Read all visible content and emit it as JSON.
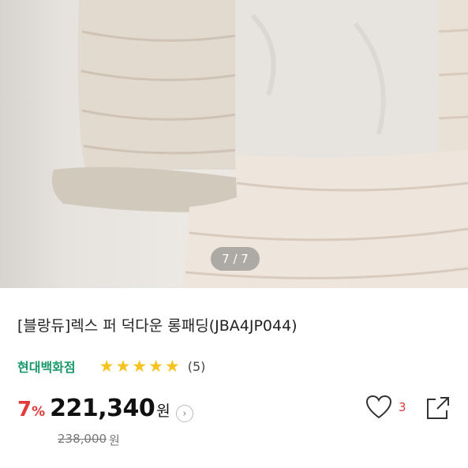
{
  "gallery": {
    "image_alt": "퍼 트리밍 롱패딩 상품 이미지",
    "counter": "7 / 7"
  },
  "product": {
    "title": "[블랑듀]렉스 퍼 덕다운 롱패딩(JBA4JP044)",
    "seller": "현대백화점",
    "rating_stars": 5,
    "review_count": "(5)"
  },
  "pricing": {
    "discount": "7",
    "discount_unit": "%",
    "price": "221,340",
    "currency": "원",
    "original_price": "238,000",
    "original_currency": "원"
  },
  "actions": {
    "like_count": "3",
    "icons": [
      "heart-icon",
      "share-icon",
      "info-chevron-icon"
    ]
  },
  "colors": {
    "seller": "#1a9a6a",
    "discount": "#e03a3a",
    "star": "#f6c21b"
  }
}
